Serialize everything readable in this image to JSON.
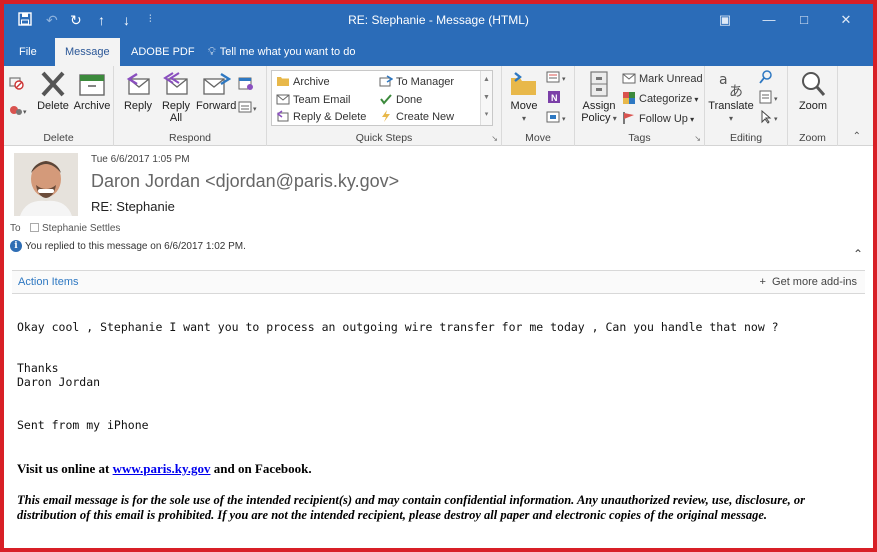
{
  "window": {
    "title": "RE: Stephanie  -  Message (HTML)",
    "icons": [
      "save-icon",
      "undo-icon",
      "redo-icon",
      "up-icon",
      "down-icon",
      "customize-icon"
    ],
    "controls": [
      "ribbon-display-icon",
      "minimize-icon",
      "maximize-icon",
      "close-icon"
    ]
  },
  "tabs": {
    "file": "File",
    "message": "Message",
    "adobe": "ADOBE PDF",
    "tell_me": "Tell me what you want to do"
  },
  "ribbon": {
    "delete_group": {
      "label": "Delete",
      "delete": "Delete",
      "archive": "Archive"
    },
    "respond_group": {
      "label": "Respond",
      "reply": "Reply",
      "reply_all_1": "Reply",
      "reply_all_2": "All",
      "forward": "Forward"
    },
    "quick_steps": {
      "label": "Quick Steps",
      "items": [
        "Archive",
        "Team Email",
        "Reply & Delete",
        "To Manager",
        "Done",
        "Create New"
      ]
    },
    "move_group": {
      "label": "Move",
      "move": "Move"
    },
    "tags_group": {
      "label": "Tags",
      "assign_1": "Assign",
      "assign_2": "Policy",
      "mark_unread": "Mark Unread",
      "categorize": "Categorize",
      "follow_up": "Follow Up"
    },
    "editing_group": {
      "label": "Editing",
      "translate": "Translate"
    },
    "zoom_group": {
      "label": "Zoom",
      "zoom": "Zoom"
    }
  },
  "header": {
    "date": "Tue 6/6/2017 1:05 PM",
    "sender": "Daron Jordan <djordan@paris.ky.gov>",
    "subject": "RE: Stephanie",
    "to_label": "To",
    "to_name": "Stephanie Settles",
    "replied_text": "You replied to this message on 6/6/2017 1:02 PM."
  },
  "actionbar": {
    "action_items": "Action Items",
    "addins": "Get more add-ins"
  },
  "body": {
    "line1": "Okay cool , Stephanie I want you to process an outgoing wire transfer for me today , Can you handle that now ?",
    "thanks": "Thanks",
    "signature": "Daron Jordan",
    "sent_from": "Sent from my iPhone",
    "visit_pre": "Visit us online at ",
    "visit_link": "www.paris.ky.gov",
    "visit_post": " and on Facebook.",
    "disclaimer": "This email message is for the sole use of the intended recipient(s) and may contain confidential information. Any unauthorized review, use, disclosure, or distribution of this email is prohibited. If you are not the intended recipient, please destroy all paper and electronic copies of the original message."
  },
  "colors": {
    "title_bar": "#2b6cb8",
    "frame_border": "#d81f26",
    "link": "#0000ee",
    "action_items": "#2e78c2"
  }
}
